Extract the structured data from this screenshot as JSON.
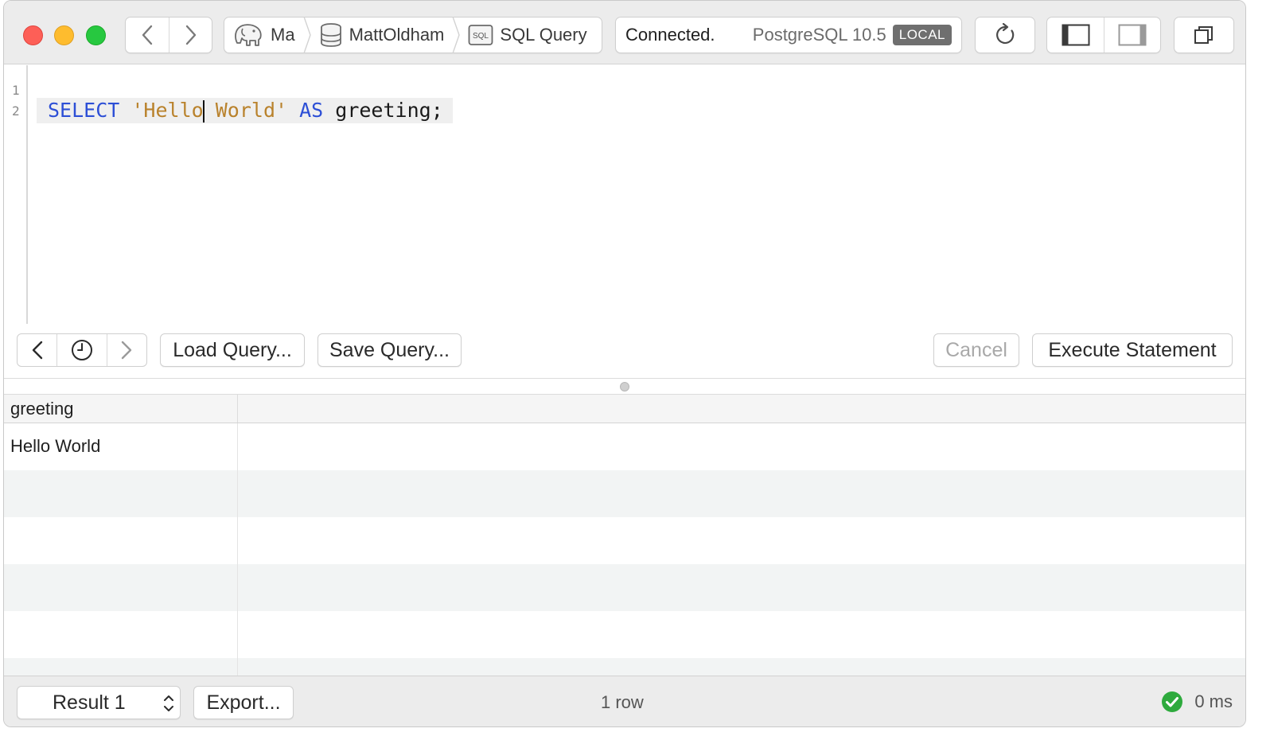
{
  "titlebar": {
    "breadcrumbs": [
      {
        "label": "Ma",
        "icon": "postgres-elephant-icon"
      },
      {
        "label": "MattOldham",
        "icon": "database-icon"
      },
      {
        "label": "SQL Query",
        "icon": "sql-file-icon",
        "icon_text": "SQL"
      }
    ],
    "status": "Connected.",
    "server": "PostgreSQL 10.5",
    "badge": "LOCAL"
  },
  "editor": {
    "line_numbers": [
      "1",
      "2"
    ],
    "tokens": {
      "select": "SELECT",
      "str_a": "'Hello",
      "str_b": " World'",
      "as": "AS",
      "ident": "greeting;"
    }
  },
  "toolbar": {
    "load": "Load Query...",
    "save": "Save Query...",
    "cancel": "Cancel",
    "execute": "Execute Statement"
  },
  "results": {
    "columns": [
      "greeting"
    ],
    "rows": [
      [
        "Hello World"
      ]
    ]
  },
  "statusbar": {
    "result_select": "Result 1",
    "export": "Export...",
    "row_count": "1 row",
    "time": "0 ms"
  },
  "colors": {
    "keyword": "#2d4fd6",
    "string": "#b9822c",
    "success": "#2eaa3d",
    "close": "#fd5f57",
    "minimize": "#febc2e",
    "zoom": "#27c840"
  }
}
